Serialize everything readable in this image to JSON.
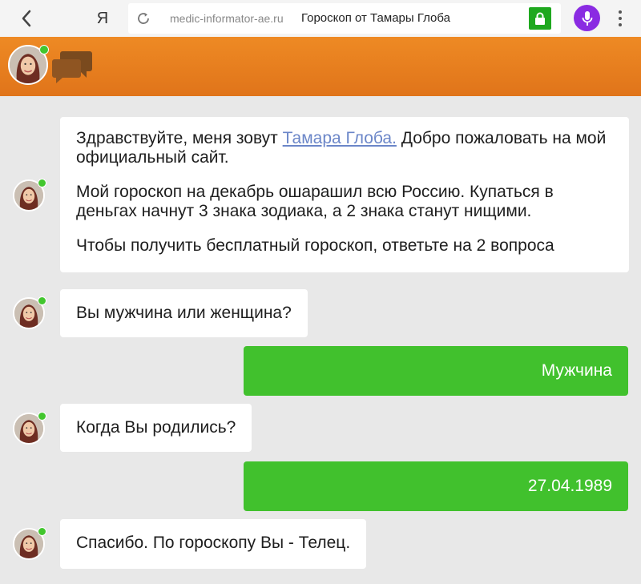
{
  "browser": {
    "url": "medic-informator-ae.ru",
    "page_title": "Гороскоп от Тамары Глоба",
    "yandex_label": "Я"
  },
  "messages": [
    {
      "from": "bot",
      "paragraphs": [
        {
          "before": "Здравствуйте, меня зовут ",
          "link": "Тамара Глоба.",
          "after": " Добро пожаловать на мой официальный сайт."
        },
        {
          "text": "Мой гороскоп на декабрь ошарашил всю Россию. Купаться в деньгах начнут 3 знака зодиака, а 2 знака станут нищими."
        },
        {
          "text": "Чтобы получить бесплатный гороскоп, ответьте на 2 вопроса"
        }
      ]
    },
    {
      "from": "bot",
      "text": "Вы мужчина или женщина?"
    },
    {
      "from": "user",
      "text": "Мужчина"
    },
    {
      "from": "bot",
      "text": "Когда Вы родились?"
    },
    {
      "from": "user",
      "text": "27.04.1989"
    },
    {
      "from": "bot",
      "text": "Спасибо. По гороскопу Вы - Телец."
    }
  ],
  "colors": {
    "header_orange": "#e8801f",
    "user_bubble": "#41c12d",
    "online_dot": "#42c62e",
    "link": "#6b86c8",
    "mic": "#8a2be2",
    "lock": "#1fa81f"
  },
  "icons": [
    "back-arrow-icon",
    "reload-icon",
    "lock-icon",
    "microphone-icon",
    "more-vert-icon",
    "chat-bubbles-icon",
    "avatar"
  ]
}
